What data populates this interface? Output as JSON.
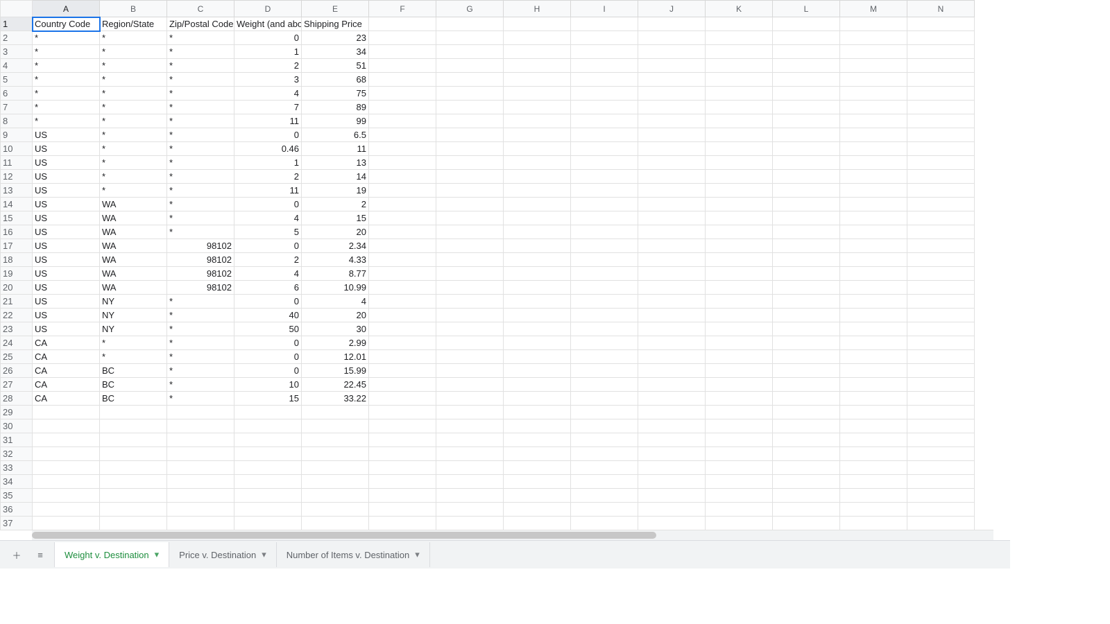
{
  "columns": [
    "A",
    "B",
    "C",
    "D",
    "E",
    "F",
    "G",
    "H",
    "I",
    "J",
    "K",
    "L",
    "M",
    "N"
  ],
  "row_count": 37,
  "headers": {
    "A": "Country Code",
    "B": "Region/State",
    "C": "Zip/Postal Code",
    "D": "Weight (and abo",
    "E": "Shipping Price"
  },
  "data": [
    {
      "A": "*",
      "B": "*",
      "C": "*",
      "D": 0,
      "E": 23
    },
    {
      "A": "*",
      "B": "*",
      "C": "*",
      "D": 1,
      "E": 34
    },
    {
      "A": "*",
      "B": "*",
      "C": "*",
      "D": 2,
      "E": 51
    },
    {
      "A": "*",
      "B": "*",
      "C": "*",
      "D": 3,
      "E": 68
    },
    {
      "A": "*",
      "B": "*",
      "C": "*",
      "D": 4,
      "E": 75
    },
    {
      "A": "*",
      "B": "*",
      "C": "*",
      "D": 7,
      "E": 89
    },
    {
      "A": "*",
      "B": "*",
      "C": "*",
      "D": 11,
      "E": 99
    },
    {
      "A": "US",
      "B": "*",
      "C": "*",
      "D": 0,
      "E": 6.5
    },
    {
      "A": "US",
      "B": "*",
      "C": "*",
      "D": 0.46,
      "E": 11
    },
    {
      "A": "US",
      "B": "*",
      "C": "*",
      "D": 1,
      "E": 13
    },
    {
      "A": "US",
      "B": "*",
      "C": "*",
      "D": 2,
      "E": 14
    },
    {
      "A": "US",
      "B": "*",
      "C": "*",
      "D": 11,
      "E": 19
    },
    {
      "A": "US",
      "B": "WA",
      "C": "*",
      "D": 0,
      "E": 2
    },
    {
      "A": "US",
      "B": "WA",
      "C": "*",
      "D": 4,
      "E": 15
    },
    {
      "A": "US",
      "B": "WA",
      "C": "*",
      "D": 5,
      "E": 20
    },
    {
      "A": "US",
      "B": "WA",
      "C": 98102,
      "D": 0,
      "E": 2.34
    },
    {
      "A": "US",
      "B": "WA",
      "C": 98102,
      "D": 2,
      "E": 4.33
    },
    {
      "A": "US",
      "B": "WA",
      "C": 98102,
      "D": 4,
      "E": 8.77
    },
    {
      "A": "US",
      "B": "WA",
      "C": 98102,
      "D": 6,
      "E": 10.99
    },
    {
      "A": "US",
      "B": "NY",
      "C": "*",
      "D": 0,
      "E": 4
    },
    {
      "A": "US",
      "B": "NY",
      "C": "*",
      "D": 40,
      "E": 20
    },
    {
      "A": "US",
      "B": "NY",
      "C": "*",
      "D": 50,
      "E": 30
    },
    {
      "A": "CA",
      "B": "*",
      "C": "*",
      "D": 0,
      "E": 2.99
    },
    {
      "A": "CA",
      "B": "*",
      "C": "*",
      "D": 0,
      "E": 12.01
    },
    {
      "A": "CA",
      "B": "BC",
      "C": "*",
      "D": 0,
      "E": 15.99
    },
    {
      "A": "CA",
      "B": "BC",
      "C": "*",
      "D": 10,
      "E": 22.45
    },
    {
      "A": "CA",
      "B": "BC",
      "C": "*",
      "D": 15,
      "E": 33.22
    }
  ],
  "active_cell": {
    "row": 1,
    "col": "A"
  },
  "tabs": [
    {
      "label": "Weight v. Destination",
      "active": true
    },
    {
      "label": "Price v. Destination",
      "active": false
    },
    {
      "label": "Number of Items v. Destination",
      "active": false
    }
  ],
  "icons": {
    "add": "＋",
    "all_sheets": "≡",
    "caret": "▾"
  }
}
